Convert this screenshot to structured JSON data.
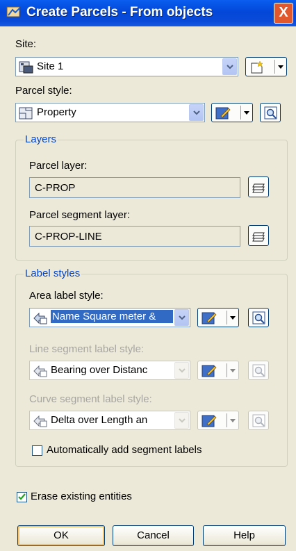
{
  "window": {
    "title": "Create Parcels - From objects",
    "close_label": "X"
  },
  "site": {
    "label": "Site:",
    "value": "Site 1"
  },
  "parcel_style": {
    "label": "Parcel style:",
    "value": "Property"
  },
  "layers": {
    "group_label": "Layers",
    "parcel_layer_label": "Parcel layer:",
    "parcel_layer_value": "C-PROP",
    "segment_layer_label": "Parcel segment layer:",
    "segment_layer_value": "C-PROP-LINE"
  },
  "label_styles": {
    "group_label": "Label styles",
    "area_label": "Area label style:",
    "area_value": "Name Square meter &",
    "line_label": "Line segment label style:",
    "line_value": "Bearing over Distanc",
    "curve_label": "Curve segment label style:",
    "curve_value": "Delta over Length an",
    "auto_add_label": "Automatically add segment labels",
    "auto_add_checked": false
  },
  "erase_label": "Erase existing entities",
  "erase_checked": true,
  "buttons": {
    "ok": "OK",
    "cancel": "Cancel",
    "help": "Help"
  }
}
